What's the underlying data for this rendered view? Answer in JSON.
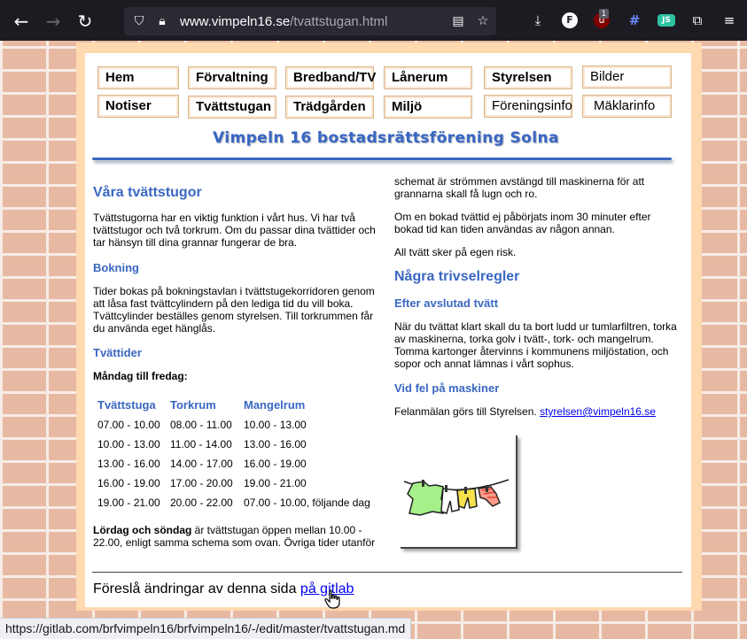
{
  "browser": {
    "url_domain": "www.vimpeln16.se",
    "url_path": "/tvattstugan.html",
    "status_url": "https://gitlab.com/brfvimpeln16/brfvimpeln16/-/edit/master/tvattstugan.md",
    "ext_f": "F",
    "ext_u_badge": "1",
    "ext_js": "JS"
  },
  "nav": {
    "row1": [
      "Hem",
      "Förvaltning",
      "Bredband/TV",
      "Lånerum",
      "Styrelsen",
      "Bilder"
    ],
    "row2": [
      "Notiser",
      "Tvättstugan",
      "Trädgården",
      "Miljö",
      "Föreningsinfo",
      "Mäklarinfo"
    ]
  },
  "site_title": "Vimpeln 16 bostadsrättsförening Solna",
  "left": {
    "heading": "Våra tvättstugor",
    "intro": "Tvättstugorna har en viktig funktion i vårt hus. Vi har två tvättstugor och två torkrum. Om du passar dina tvättider och tar hänsyn till dina grannar fungerar de bra.",
    "bokning_heading": "Bokning",
    "bokning_text": "Tider bokas på bokningstavlan i tvättstugekorridoren genom att låsa fast tvättcylindern på den lediga tid du vill boka. Tvättcylinder beställes genom styrelsen. Till torkrummen får du använda eget hänglås.",
    "tvattider_heading": "Tvättider",
    "weekday_label": "Måndag till fredag:",
    "schedule": {
      "headers": [
        "Tvättstuga",
        "Torkrum",
        "Mangelrum"
      ],
      "rows": [
        [
          "07.00 - 10.00",
          "08.00 - 11.00",
          "10.00 - 13.00"
        ],
        [
          "10.00 - 13.00",
          "11.00 - 14.00",
          "13.00 - 16.00"
        ],
        [
          "13.00 - 16.00",
          "14.00 - 17.00",
          "16.00 - 19.00"
        ],
        [
          "16.00 - 19.00",
          "17.00 - 20.00",
          "19.00 - 21.00"
        ],
        [
          "19.00 - 21.00",
          "20.00 - 22.00",
          "07.00 - 10.00, följande dag"
        ]
      ]
    },
    "weekend_bold": "Lördag och söndag",
    "weekend_text": " är tvättstugan öppen mellan 10.00 - 22.00, enligt samma schema som ovan. Övriga tider utanför"
  },
  "right": {
    "cont1": "schemat är strömmen avstängd till maskinerna för att grannarna skall få lugn och ro.",
    "cont2": "Om en bokad tvättid ej påbörjats inom 30 minuter efter bokad tid kan tiden användas av någon annan.",
    "cont3": "All tvätt sker på egen risk.",
    "rules_heading": "Några trivselregler",
    "after_heading": "Efter avslutad tvätt",
    "after_text": "När du tvättat klart skall du ta bort ludd ur tumlarfiltren, torka av maskinerna, torka golv i tvätt-, tork- och mangelrum. Tomma kartonger återvinns i kommunens miljöstation, och sopor och annat lämnas i vårt sophus.",
    "fault_heading": "Vid fel på maskiner",
    "fault_text": "Felanmälan görs till Styrelsen. ",
    "fault_email": "styrelsen@vimpeln16.se"
  },
  "footer": {
    "text": "Föreslå ändringar av denna sida ",
    "link": "på gitlab"
  },
  "colors": {
    "heading_blue": "#3a67c2",
    "frame_peach": "#ffd9b0",
    "brick": "#e8b9a2"
  }
}
